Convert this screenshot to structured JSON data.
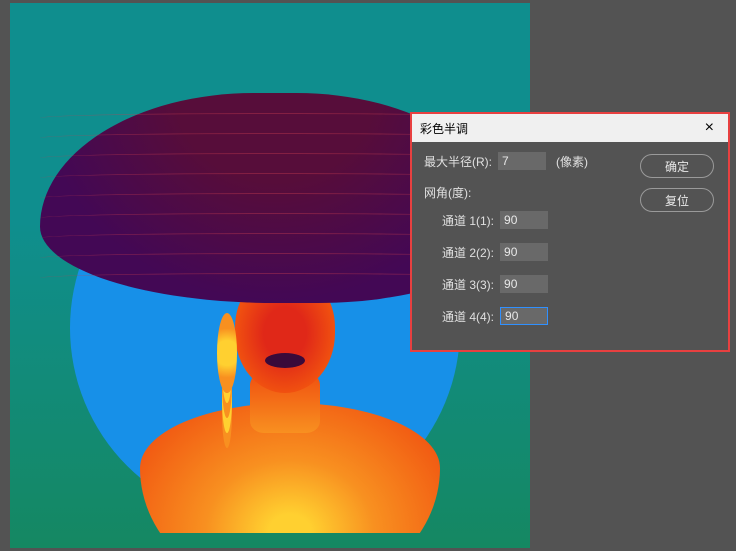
{
  "dialog": {
    "title": "彩色半调",
    "maxRadiusLabel": "最大半径(R):",
    "maxRadiusValue": "7",
    "pixelsLabel": "(像素)",
    "gridAngleLabel": "网角(度):",
    "channels": [
      {
        "label": "通道 1(1):",
        "value": "90"
      },
      {
        "label": "通道 2(2):",
        "value": "90"
      },
      {
        "label": "通道 3(3):",
        "value": "90"
      },
      {
        "label": "通道 4(4):",
        "value": "90"
      }
    ],
    "okButton": "确定",
    "resetButton": "复位",
    "closeIcon": "×"
  }
}
